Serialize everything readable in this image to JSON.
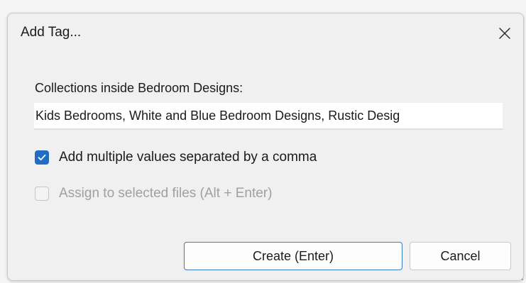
{
  "dialog": {
    "title": "Add Tag...",
    "close_icon": "close-icon"
  },
  "form": {
    "collections_label": "Collections inside Bedroom Designs:",
    "collections_value": "Kids Bedrooms, White and Blue Bedroom Designs, Rustic Desig"
  },
  "options": {
    "multiple_values": {
      "label": "Add multiple values separated by a comma",
      "checked": true,
      "enabled": true
    },
    "assign_selected": {
      "label": "Assign to selected files (Alt + Enter)",
      "checked": false,
      "enabled": false
    }
  },
  "buttons": {
    "create_label": "Create (Enter)",
    "cancel_label": "Cancel"
  },
  "colors": {
    "accent": "#1f6dc4",
    "primary_button_border": "#3b7cc0",
    "disabled_text": "#a0a0a0"
  }
}
